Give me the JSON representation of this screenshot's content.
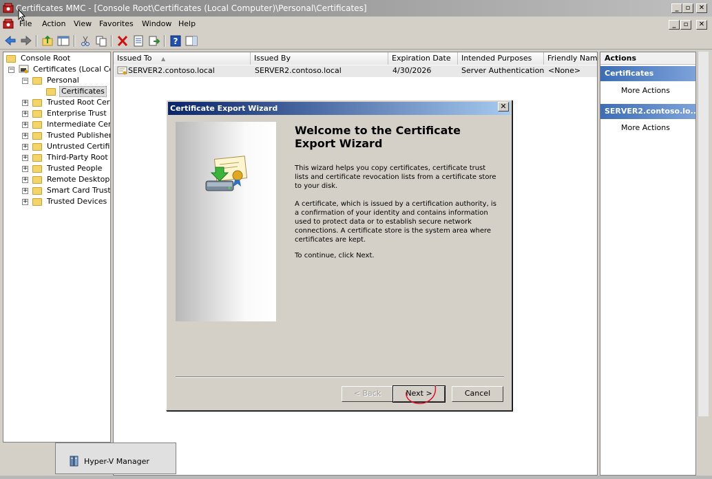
{
  "window": {
    "title": "Certificates MMC - [Console Root\\Certificates (Local Computer)\\Personal\\Certificates]"
  },
  "menu": [
    "File",
    "Action",
    "View",
    "Favorites",
    "Window",
    "Help"
  ],
  "toolbar": {
    "icons": [
      "back-icon",
      "forward-icon",
      "up-folder-icon",
      "show-tree-icon",
      "cut-icon",
      "copy-icon",
      "delete-icon",
      "properties-icon",
      "export-icon",
      "help-icon",
      "show-action-pane-icon"
    ]
  },
  "tree": {
    "items": [
      {
        "label": "Console Root",
        "level": 0,
        "expander": ""
      },
      {
        "label": "Certificates (Local Com",
        "level": 1,
        "expander": "−"
      },
      {
        "label": "Personal",
        "level": 2,
        "expander": "−"
      },
      {
        "label": "Certificates",
        "level": 3,
        "expander": "",
        "selected": true
      },
      {
        "label": "Trusted Root Certi",
        "level": 2,
        "expander": "+"
      },
      {
        "label": "Enterprise Trust",
        "level": 2,
        "expander": "+"
      },
      {
        "label": "Intermediate Certi",
        "level": 2,
        "expander": "+"
      },
      {
        "label": "Trusted Publishers",
        "level": 2,
        "expander": "+"
      },
      {
        "label": "Untrusted Certifica",
        "level": 2,
        "expander": "+"
      },
      {
        "label": "Third-Party Root C",
        "level": 2,
        "expander": "+"
      },
      {
        "label": "Trusted People",
        "level": 2,
        "expander": "+"
      },
      {
        "label": "Remote Desktop",
        "level": 2,
        "expander": "+"
      },
      {
        "label": "Smart Card Trusted",
        "level": 2,
        "expander": "+"
      },
      {
        "label": "Trusted Devices",
        "level": 2,
        "expander": "+"
      }
    ]
  },
  "list": {
    "columns": [
      "Issued To",
      "Issued By",
      "Expiration Date",
      "Intended Purposes",
      "Friendly Name"
    ],
    "sort_indicator": "▲",
    "rows": [
      [
        "SERVER2.contoso.local",
        "SERVER2.contoso.local",
        "4/30/2026",
        "Server Authentication",
        "<None>"
      ]
    ]
  },
  "actions": {
    "title": "Actions",
    "sections": [
      {
        "header": "Certificates",
        "link": "More Actions"
      },
      {
        "header": "SERVER2.contoso.lo...",
        "link": "More Actions"
      }
    ]
  },
  "dialog": {
    "title": "Certificate Export Wizard",
    "close": "✕",
    "heading": "Welcome to the Certificate Export Wizard",
    "paragraphs": [
      "This wizard helps you copy certificates, certificate trust lists and certificate revocation lists from a certificate store to your disk.",
      "A certificate, which is issued by a certification authority, is a confirmation of your identity and contains information used to protect data or to establish secure network connections. A certificate store is the system area where certificates are kept.",
      "To continue, click Next."
    ],
    "buttons": {
      "back": "< Back",
      "next": "Next >",
      "cancel": "Cancel"
    },
    "annotation_color": "#e0102a"
  },
  "taskbar": {
    "popup_label": "Hyper-V Manager"
  }
}
